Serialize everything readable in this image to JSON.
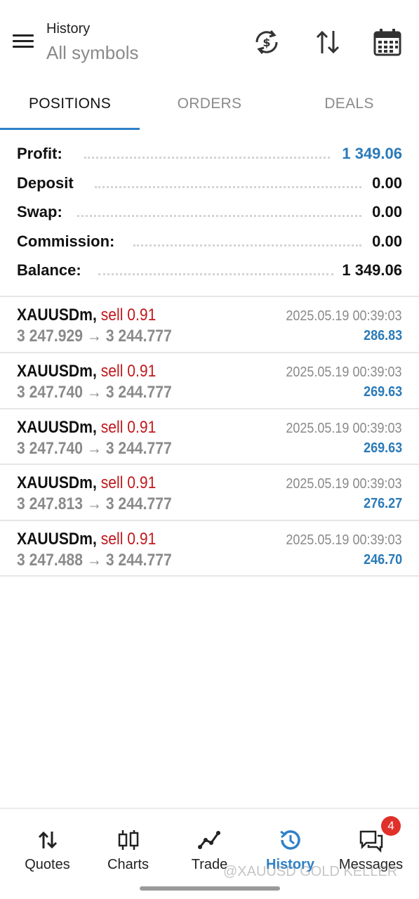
{
  "header": {
    "title": "History",
    "subtitle": "All symbols",
    "icons": [
      "menu-icon",
      "currency-exchange-icon",
      "sort-icon",
      "calendar-icon"
    ]
  },
  "tabs": [
    {
      "label": "POSITIONS",
      "active": true
    },
    {
      "label": "ORDERS",
      "active": false
    },
    {
      "label": "DEALS",
      "active": false
    }
  ],
  "summary": {
    "profit": {
      "label": "Profit:",
      "value": "1 349.06"
    },
    "deposit": {
      "label": "Deposit",
      "value": "0.00"
    },
    "swap": {
      "label": "Swap:",
      "value": "0.00"
    },
    "commission": {
      "label": "Commission:",
      "value": "0.00"
    },
    "balance": {
      "label": "Balance:",
      "value": "1 349.06"
    }
  },
  "positions": [
    {
      "symbol": "XAUUSDm,",
      "side": "sell 0.91",
      "prices": "3 247.929 → 3 244.777",
      "time": "2025.05.19 00:39:03",
      "profit": "286.83"
    },
    {
      "symbol": "XAUUSDm,",
      "side": "sell 0.91",
      "prices": "3 247.740 → 3 244.777",
      "time": "2025.05.19 00:39:03",
      "profit": "269.63"
    },
    {
      "symbol": "XAUUSDm,",
      "side": "sell 0.91",
      "prices": "3 247.740 → 3 244.777",
      "time": "2025.05.19 00:39:03",
      "profit": "269.63"
    },
    {
      "symbol": "XAUUSDm,",
      "side": "sell 0.91",
      "prices": "3 247.813 → 3 244.777",
      "time": "2025.05.19 00:39:03",
      "profit": "276.27"
    },
    {
      "symbol": "XAUUSDm,",
      "side": "sell 0.91",
      "prices": "3 247.488 → 3 244.777",
      "time": "2025.05.19 00:39:03",
      "profit": "246.70"
    }
  ],
  "nav": [
    {
      "label": "Quotes",
      "icon": "quotes-icon"
    },
    {
      "label": "Charts",
      "icon": "charts-icon"
    },
    {
      "label": "Trade",
      "icon": "trade-icon"
    },
    {
      "label": "History",
      "icon": "history-icon",
      "active": true
    },
    {
      "label": "Messages",
      "icon": "messages-icon",
      "badge": "4"
    }
  ],
  "watermark": "@XAUUSD GOLD KELLER",
  "colors": {
    "accent": "#2f80c8",
    "profit_blue": "#2a7ab8",
    "sell_red": "#c0191d",
    "badge_red": "#e0302a",
    "muted_gray": "#8a8a8a"
  }
}
